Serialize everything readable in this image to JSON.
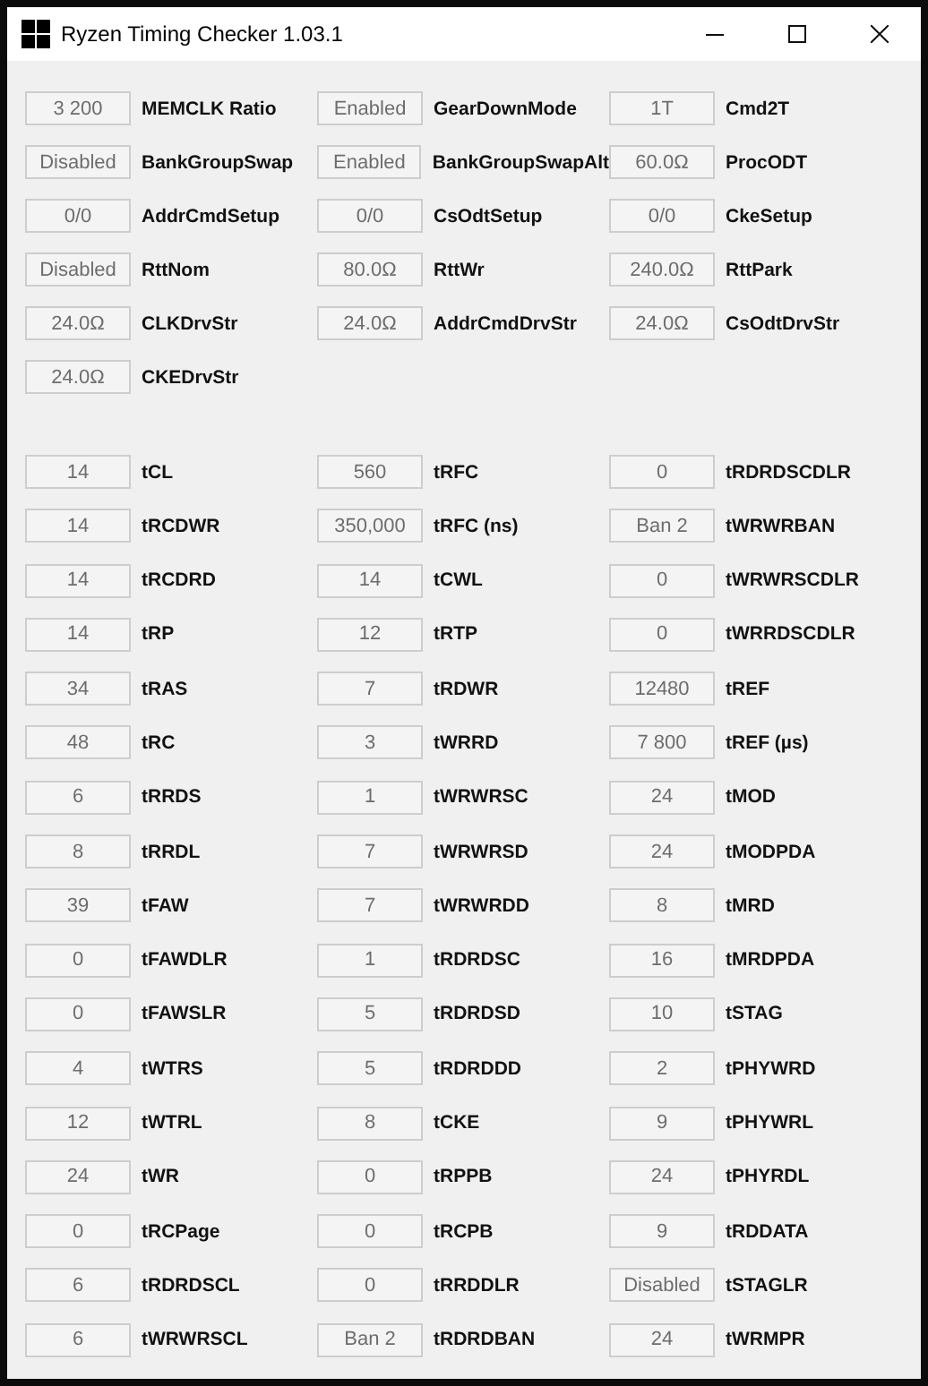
{
  "window": {
    "title": "Ryzen Timing Checker 1.03.1"
  },
  "settings": {
    "columns": [
      {
        "items": [
          {
            "label": "MEMCLK Ratio",
            "value": "3 200"
          },
          {
            "label": "BankGroupSwap",
            "value": "Disabled"
          },
          {
            "label": "AddrCmdSetup",
            "value": "0/0"
          },
          {
            "label": "RttNom",
            "value": "Disabled"
          },
          {
            "label": "CLKDrvStr",
            "value": "24.0Ω"
          },
          {
            "label": "CKEDrvStr",
            "value": "24.0Ω"
          }
        ]
      },
      {
        "items": [
          {
            "label": "GearDownMode",
            "value": "Enabled"
          },
          {
            "label": "BankGroupSwapAlt",
            "value": "Enabled"
          },
          {
            "label": "CsOdtSetup",
            "value": "0/0"
          },
          {
            "label": "RttWr",
            "value": "80.0Ω"
          },
          {
            "label": "AddrCmdDrvStr",
            "value": "24.0Ω"
          }
        ]
      },
      {
        "items": [
          {
            "label": "Cmd2T",
            "value": "1T"
          },
          {
            "label": "ProcODT",
            "value": "60.0Ω"
          },
          {
            "label": "CkeSetup",
            "value": "0/0"
          },
          {
            "label": "RttPark",
            "value": "240.0Ω"
          },
          {
            "label": "CsOdtDrvStr",
            "value": "24.0Ω"
          }
        ]
      }
    ]
  },
  "timings": {
    "columns": [
      {
        "items": [
          {
            "label": "tCL",
            "value": "14"
          },
          {
            "label": "tRCDWR",
            "value": "14"
          },
          {
            "label": "tRCDRD",
            "value": "14"
          },
          {
            "label": "tRP",
            "value": "14"
          },
          {
            "label": "tRAS",
            "value": "34"
          },
          {
            "label": "tRC",
            "value": "48"
          },
          {
            "label": "tRRDS",
            "value": "6"
          },
          {
            "label": "tRRDL",
            "value": "8"
          },
          {
            "label": "tFAW",
            "value": "39"
          },
          {
            "label": "tFAWDLR",
            "value": "0"
          },
          {
            "label": "tFAWSLR",
            "value": "0"
          },
          {
            "label": "tWTRS",
            "value": "4"
          },
          {
            "label": "tWTRL",
            "value": "12"
          },
          {
            "label": "tWR",
            "value": "24"
          },
          {
            "label": "tRCPage",
            "value": "0"
          },
          {
            "label": "tRDRDSCL",
            "value": "6"
          },
          {
            "label": "tWRWRSCL",
            "value": "6"
          }
        ]
      },
      {
        "items": [
          {
            "label": "tRFC",
            "value": "560"
          },
          {
            "label": "tRFC (ns)",
            "value": "350,000"
          },
          {
            "label": "tCWL",
            "value": "14"
          },
          {
            "label": "tRTP",
            "value": "12"
          },
          {
            "label": "tRDWR",
            "value": "7"
          },
          {
            "label": "tWRRD",
            "value": "3"
          },
          {
            "label": "tWRWRSC",
            "value": "1"
          },
          {
            "label": "tWRWRSD",
            "value": "7"
          },
          {
            "label": "tWRWRDD",
            "value": "7"
          },
          {
            "label": "tRDRDSC",
            "value": "1"
          },
          {
            "label": "tRDRDSD",
            "value": "5"
          },
          {
            "label": "tRDRDDD",
            "value": "5"
          },
          {
            "label": "tCKE",
            "value": "8"
          },
          {
            "label": "tRPPB",
            "value": "0"
          },
          {
            "label": "tRCPB",
            "value": "0"
          },
          {
            "label": "tRRDDLR",
            "value": "0"
          },
          {
            "label": "tRDRDBAN",
            "value": "Ban 2"
          }
        ]
      },
      {
        "items": [
          {
            "label": "tRDRDSCDLR",
            "value": "0"
          },
          {
            "label": "tWRWRBAN",
            "value": "Ban 2"
          },
          {
            "label": "tWRWRSCDLR",
            "value": "0"
          },
          {
            "label": "tWRRDSCDLR",
            "value": "0"
          },
          {
            "label": "tREF",
            "value": "12480"
          },
          {
            "label": "tREF (µs)",
            "value": "7 800"
          },
          {
            "label": "tMOD",
            "value": "24"
          },
          {
            "label": "tMODPDA",
            "value": "24"
          },
          {
            "label": "tMRD",
            "value": "8"
          },
          {
            "label": "tMRDPDA",
            "value": "16"
          },
          {
            "label": "tSTAG",
            "value": "10"
          },
          {
            "label": "tPHYWRD",
            "value": "2"
          },
          {
            "label": "tPHYWRL",
            "value": "9"
          },
          {
            "label": "tPHYRDL",
            "value": "24"
          },
          {
            "label": "tRDDATA",
            "value": "9"
          },
          {
            "label": "tSTAGLR",
            "value": "Disabled"
          },
          {
            "label": "tWRMPR",
            "value": "24"
          }
        ]
      }
    ]
  }
}
